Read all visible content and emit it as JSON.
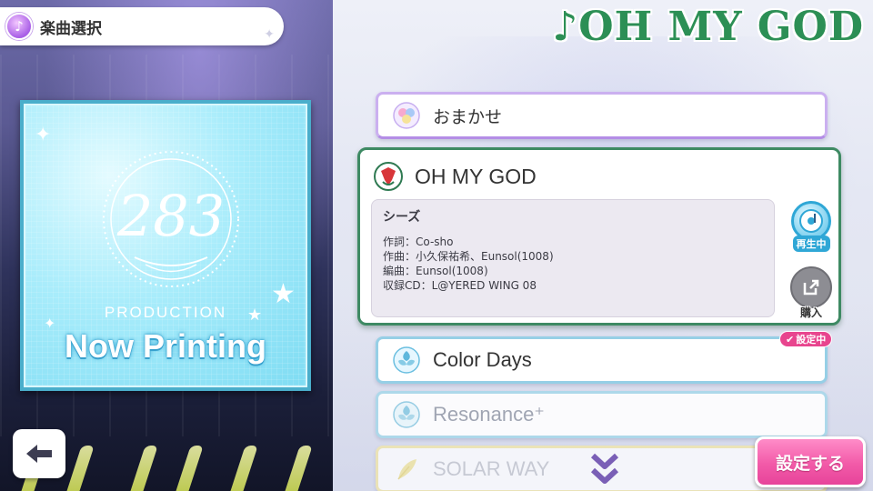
{
  "header": {
    "title": "楽曲選択",
    "icon": "music-note-icon"
  },
  "now_playing_title": "♪OH MY GOD",
  "jacket": {
    "production_text": "PRODUCTION",
    "status_text": "Now Printing",
    "emblem_text": "283"
  },
  "song_list": {
    "omakase": {
      "label": "おまかせ",
      "icon": "clover-icon"
    },
    "selected": {
      "title": "OH MY GOD",
      "icon": "shhis-unit-icon",
      "unit": "シーズ",
      "lyrics": "作詞：Co-sho",
      "composer": "作曲：小久保祐希、Eunsol(1008)",
      "arranger": "編曲：Eunsol(1008)",
      "cd": "収録CD：L@YERED WING 08",
      "play_label": "再生中",
      "buy_label": "購入"
    },
    "items": [
      {
        "label": "Color Days",
        "icon": "flower-icon",
        "badge": "設定中"
      },
      {
        "label": "Resonance⁺",
        "icon": "flower-icon"
      },
      {
        "label": "SOLAR WAY",
        "icon": "leaf-icon"
      }
    ]
  },
  "buttons": {
    "confirm": "設定する",
    "back": "back-arrow-icon"
  },
  "colors": {
    "accent_pink": "#e7449a",
    "selected_border": "#3e8a63",
    "title_green": "#2c8f55"
  }
}
